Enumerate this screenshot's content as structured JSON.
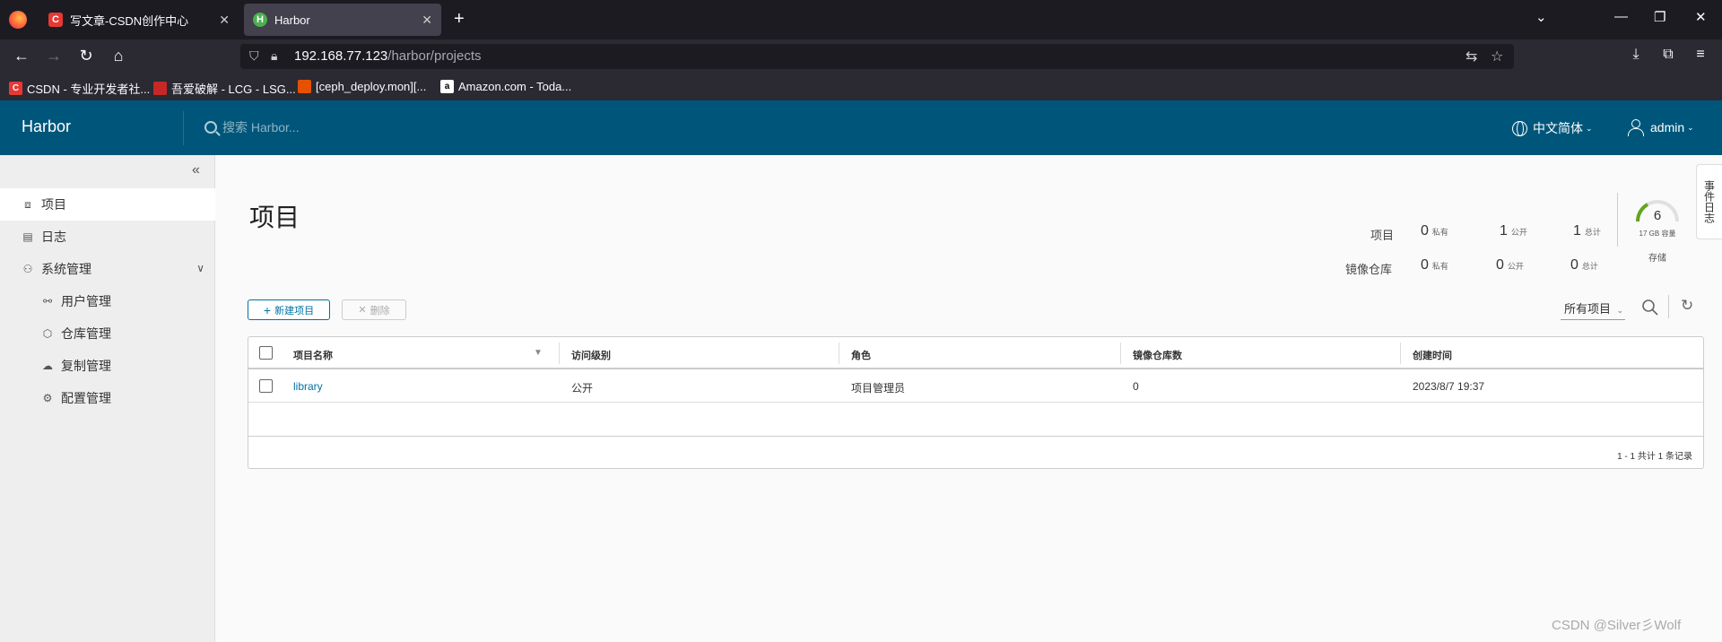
{
  "browser": {
    "tabs": [
      {
        "title": "写文章-CSDN创作中心",
        "favicon": "C"
      },
      {
        "title": "Harbor",
        "favicon": "H"
      }
    ],
    "url_host": "192.168.77.123",
    "url_path": "/harbor/projects",
    "bookmarks": [
      {
        "label": "CSDN - 专业开发者社...",
        "color": "#e53935",
        "fav": "C"
      },
      {
        "label": "吾爱破解 - LCG - LSG...",
        "color": "#c62828",
        "fav": ""
      },
      {
        "label": "[ceph_deploy.mon][...",
        "color": "#e65100",
        "fav": ""
      },
      {
        "label": "Amazon.com - Toda...",
        "color": "#ffffff",
        "fav": "a"
      }
    ]
  },
  "header": {
    "brand": "Harbor",
    "search_placeholder": "搜索 Harbor...",
    "language": "中文简体",
    "user": "admin"
  },
  "sidebar": {
    "items": [
      {
        "label": "项目",
        "icon": "projects-icon"
      },
      {
        "label": "日志",
        "icon": "logs-icon"
      },
      {
        "label": "系统管理",
        "icon": "admin-icon"
      },
      {
        "label": "用户管理",
        "icon": "users-icon"
      },
      {
        "label": "仓库管理",
        "icon": "registry-icon"
      },
      {
        "label": "复制管理",
        "icon": "replication-icon"
      },
      {
        "label": "配置管理",
        "icon": "config-icon"
      }
    ]
  },
  "main": {
    "title": "项目",
    "stats": {
      "projects_label": "项目",
      "repos_label": "镜像仓库",
      "private_label": "私有",
      "public_label": "公开",
      "total_label": "总计",
      "projects_private": "0",
      "projects_public": "1",
      "projects_total": "1",
      "repos_private": "0",
      "repos_public": "0",
      "repos_total": "0"
    },
    "storage": {
      "value": "6",
      "capacity": "17 GB 容量",
      "label": "存储"
    },
    "new_project_label": "新建项目",
    "delete_label": "删除",
    "filter_label": "所有项目",
    "table": {
      "columns": [
        "项目名称",
        "访问级别",
        "角色",
        "镜像仓库数",
        "创建时间"
      ],
      "rows": [
        [
          "library",
          "公开",
          "项目管理员",
          "0",
          "2023/8/7 19:37"
        ]
      ],
      "footer": "1 - 1 共计 1 条记录"
    },
    "side_tab": "事件日志"
  },
  "watermark": "CSDN @Silver彡Wolf",
  "colors": {
    "header_bg": "#00567a",
    "accent": "#0072a3"
  }
}
